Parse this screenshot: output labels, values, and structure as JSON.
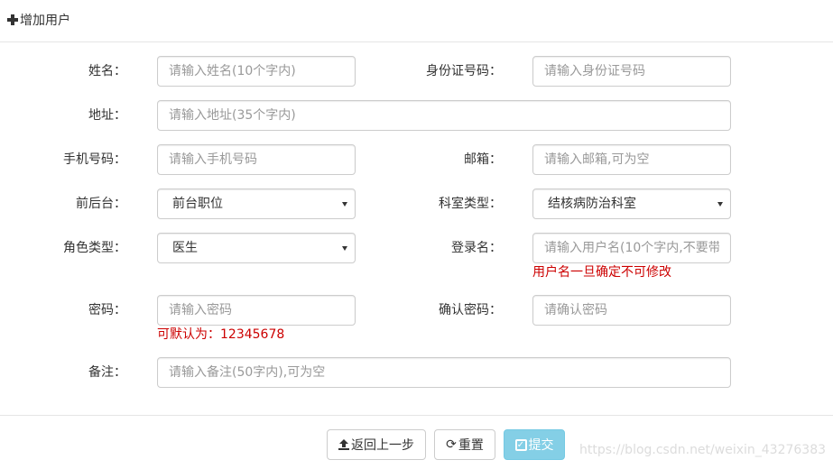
{
  "header": {
    "title": "增加用户",
    "icon": "plus-icon"
  },
  "form": {
    "name": {
      "label": "姓名：",
      "placeholder": "请输入姓名(10个字内)"
    },
    "idcard": {
      "label": "身份证号码：",
      "placeholder": "请输入身份证号码"
    },
    "address": {
      "label": "地址：",
      "placeholder": "请输入地址(35个字内)"
    },
    "phone": {
      "label": "手机号码：",
      "placeholder": "请输入手机号码"
    },
    "email": {
      "label": "邮箱：",
      "placeholder": "请输入邮箱,可为空"
    },
    "desk": {
      "label": "前后台：",
      "value": "前台职位"
    },
    "department": {
      "label": "科室类型：",
      "value": "结核病防治科室"
    },
    "role": {
      "label": "角色类型：",
      "value": "医生"
    },
    "login": {
      "label": "登录名：",
      "placeholder": "请输入用户名(10个字内,不要带",
      "hint": "用户名一旦确定不可修改"
    },
    "password": {
      "label": "密码：",
      "placeholder": "请输入密码",
      "hint": "可默认为：12345678"
    },
    "confirm": {
      "label": "确认密码：",
      "placeholder": "请确认密码"
    },
    "remark": {
      "label": "备注：",
      "placeholder": "请输入备注(50字内),可为空"
    }
  },
  "buttons": {
    "back": "返回上一步",
    "reset": "重置",
    "submit": "提交"
  },
  "watermark": "https://blog.csdn.net/weixin_43276383",
  "colors": {
    "hint": "#cc0000",
    "primary": "#5bc0de",
    "border": "#cccccc"
  }
}
